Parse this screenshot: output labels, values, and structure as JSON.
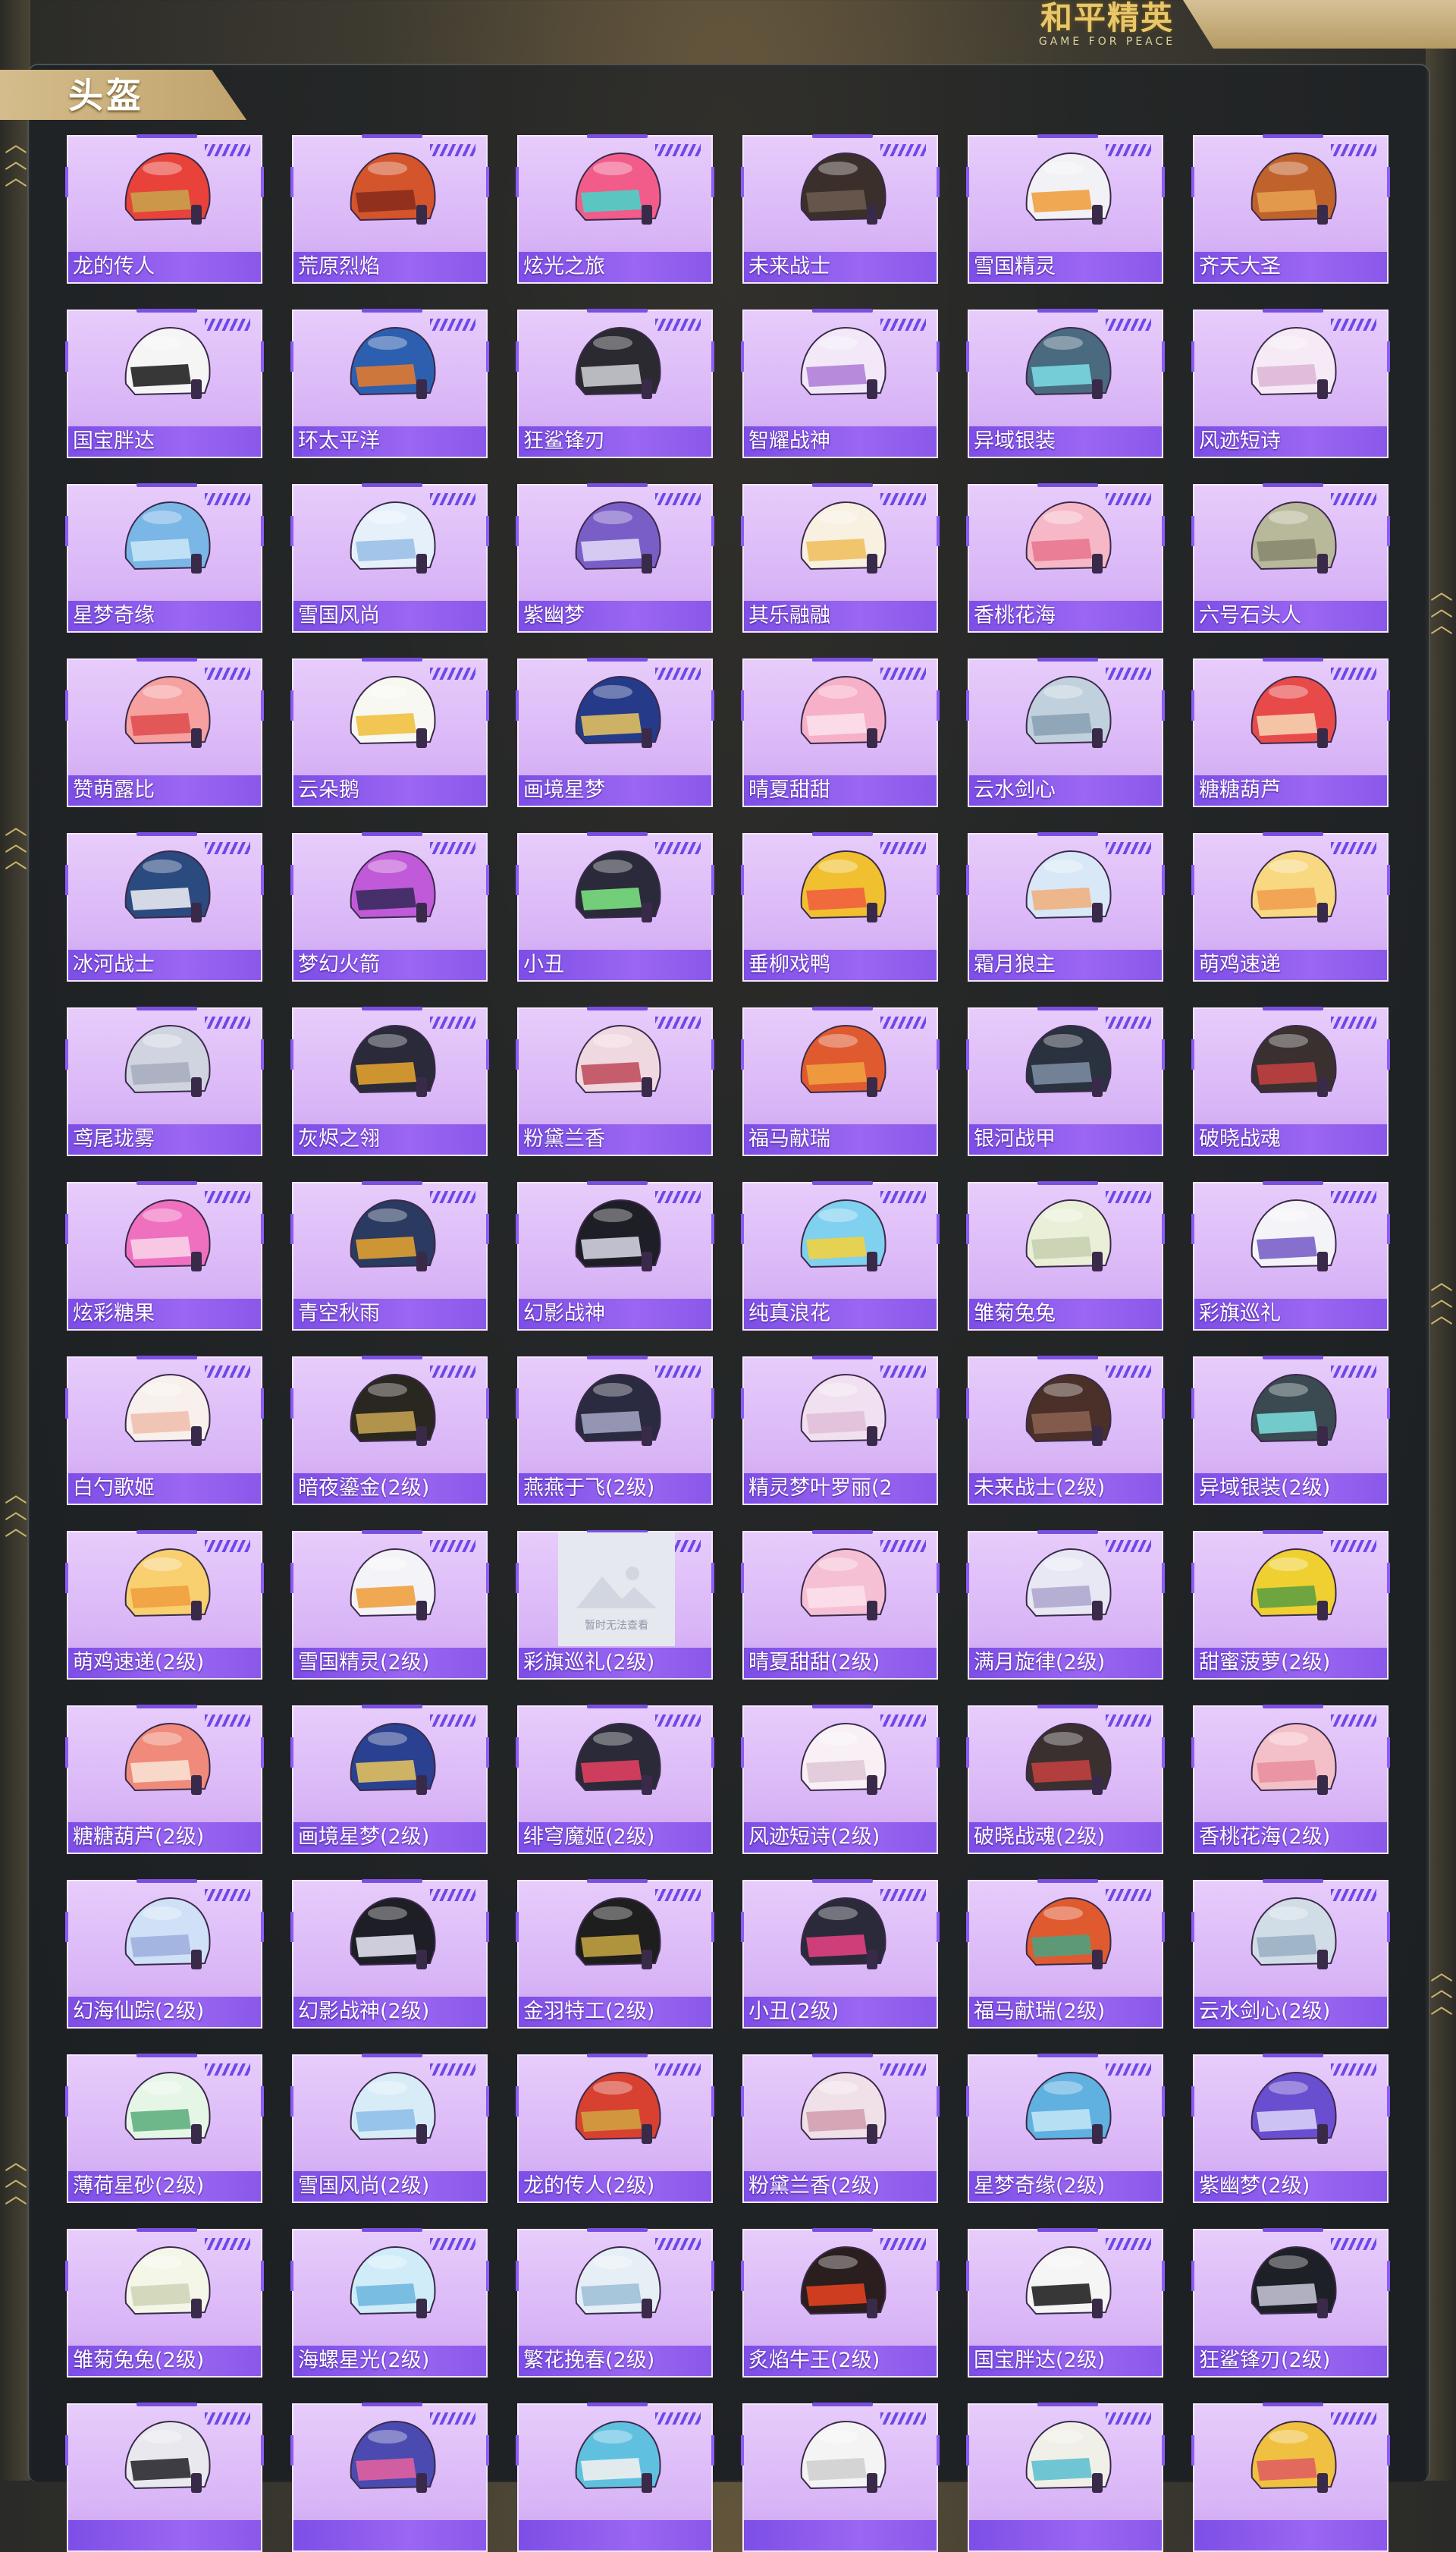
{
  "header": {
    "logo_cn": "和平精英",
    "logo_en": "GAME FOR PEACE",
    "section_title": "头盔"
  },
  "colors": {
    "card_bg": "#d8b4f6",
    "name_band": "#8a58ea",
    "title_tab": "#c8ad78",
    "logo_gold": "#e8c76a"
  },
  "placeholder_text": "暂时无法查看",
  "items": [
    {
      "name": "龙的传人",
      "c1": "#e8423a",
      "c2": "#c9a14a"
    },
    {
      "name": "荒原烈焰",
      "c1": "#d4542c",
      "c2": "#8a2d1c"
    },
    {
      "name": "炫光之旅",
      "c1": "#f25c8a",
      "c2": "#4ad1c7"
    },
    {
      "name": "未来战士",
      "c1": "#3a2f2a",
      "c2": "#6b5a4e"
    },
    {
      "name": "雪国精灵",
      "c1": "#f2f2f6",
      "c2": "#f0a040"
    },
    {
      "name": "齐天大圣",
      "c1": "#c0622c",
      "c2": "#e6a050"
    },
    {
      "name": "国宝胖达",
      "c1": "#f5f5f5",
      "c2": "#222222"
    },
    {
      "name": "环太平洋",
      "c1": "#2d5fb0",
      "c2": "#e07a30"
    },
    {
      "name": "狂鲨锋刃",
      "c1": "#2a2a30",
      "c2": "#c9c9d0"
    },
    {
      "name": "智耀战神",
      "c1": "#f2e8f8",
      "c2": "#b080d8"
    },
    {
      "name": "异域银装",
      "c1": "#4a6a80",
      "c2": "#7ad8e0"
    },
    {
      "name": "风迹短诗",
      "c1": "#f5eaf5",
      "c2": "#e0b8d8"
    },
    {
      "name": "星梦奇缘",
      "c1": "#7ab6e6",
      "c2": "#c8e6f6"
    },
    {
      "name": "雪国风尚",
      "c1": "#e6f0fb",
      "c2": "#9cc0e8"
    },
    {
      "name": "紫幽梦",
      "c1": "#7a5ec8",
      "c2": "#e0d6f6"
    },
    {
      "name": "其乐融融",
      "c1": "#f8f0e0",
      "c2": "#f0c060"
    },
    {
      "name": "香桃花海",
      "c1": "#f6b8c6",
      "c2": "#e87890"
    },
    {
      "name": "六号石头人",
      "c1": "#b8b89a",
      "c2": "#8a8a70"
    },
    {
      "name": "赞萌露比",
      "c1": "#f6a0a0",
      "c2": "#e05050"
    },
    {
      "name": "云朵鹅",
      "c1": "#f8f8f2",
      "c2": "#f0c040"
    },
    {
      "name": "画境星梦",
      "c1": "#263a8a",
      "c2": "#e0c060"
    },
    {
      "name": "晴夏甜甜",
      "c1": "#f6b0c8",
      "c2": "#fbe0ea"
    },
    {
      "name": "云水剑心",
      "c1": "#c0d0dc",
      "c2": "#8aa2b4"
    },
    {
      "name": "糖糖葫芦",
      "c1": "#e84a4a",
      "c2": "#f6d0b0"
    },
    {
      "name": "冰河战士",
      "c1": "#2a4a80",
      "c2": "#e8e8f0"
    },
    {
      "name": "梦幻火箭",
      "c1": "#c05ad8",
      "c2": "#3a2a60"
    },
    {
      "name": "小丑",
      "c1": "#2a2a3a",
      "c2": "#7ae080"
    },
    {
      "name": "垂柳戏鸭",
      "c1": "#f0c030",
      "c2": "#f06040"
    },
    {
      "name": "霜月狼主",
      "c1": "#d8e8f6",
      "c2": "#f0b080"
    },
    {
      "name": "萌鸡速递",
      "c1": "#f8d880",
      "c2": "#f0a050"
    },
    {
      "name": "鸢尾珑雾",
      "c1": "#d0d4e0",
      "c2": "#a8aec0"
    },
    {
      "name": "灰烬之翎",
      "c1": "#2a2a3a",
      "c2": "#e0a030"
    },
    {
      "name": "粉黛兰香",
      "c1": "#f0d8e0",
      "c2": "#c05060"
    },
    {
      "name": "福马献瑞",
      "c1": "#e05a30",
      "c2": "#f0a040"
    },
    {
      "name": "银河战甲",
      "c1": "#2a3240",
      "c2": "#7a8aa0"
    },
    {
      "name": "破晓战魂",
      "c1": "#3a3030",
      "c2": "#c04040"
    },
    {
      "name": "炫彩糖果",
      "c1": "#f070c0",
      "c2": "#f8d0e8"
    },
    {
      "name": "青空秋雨",
      "c1": "#2a3a60",
      "c2": "#e0a030"
    },
    {
      "name": "幻影战神",
      "c1": "#1e1e26",
      "c2": "#d0d0e0"
    },
    {
      "name": "纯真浪花",
      "c1": "#80d0f0",
      "c2": "#f0d040"
    },
    {
      "name": "雏菊兔兔",
      "c1": "#eaf0d8",
      "c2": "#c8d0b0"
    },
    {
      "name": "彩旗巡礼",
      "c1": "#f4f4f8",
      "c2": "#7a60c8"
    },
    {
      "name": "白勺歌姬",
      "c1": "#f8f0ec",
      "c2": "#f0c0b0"
    },
    {
      "name": "暗夜鎏金(2级)",
      "c1": "#2a2620",
      "c2": "#c0a050"
    },
    {
      "name": "燕燕于飞(2级)",
      "c1": "#2a2a40",
      "c2": "#a0a0c0"
    },
    {
      "name": "精灵梦叶罗丽(2",
      "c1": "#f0e0f0",
      "c2": "#e0c0d8"
    },
    {
      "name": "未来战士(2级)",
      "c1": "#4a3028",
      "c2": "#8a6050"
    },
    {
      "name": "异域银装(2级)",
      "c1": "#3a4a50",
      "c2": "#7ad8d8"
    },
    {
      "name": "萌鸡速递(2级)",
      "c1": "#f8d070",
      "c2": "#f0a040"
    },
    {
      "name": "雪国精灵(2级)",
      "c1": "#f4f4f8",
      "c2": "#f0a040"
    },
    {
      "name": "彩旗巡礼(2级)",
      "c1": "#e6e8ef",
      "c2": "#e6e8ef",
      "placeholder": true
    },
    {
      "name": "晴夏甜甜(2级)",
      "c1": "#f6c0d4",
      "c2": "#fbe0ea"
    },
    {
      "name": "满月旋律(2级)",
      "c1": "#e8e8f4",
      "c2": "#b0a8d0"
    },
    {
      "name": "甜蜜菠萝(2级)",
      "c1": "#f0d030",
      "c2": "#60a040"
    },
    {
      "name": "糖糖葫芦(2级)",
      "c1": "#f08a7a",
      "c2": "#f8e0d0"
    },
    {
      "name": "画境星梦(2级)",
      "c1": "#2a4090",
      "c2": "#e0c060"
    },
    {
      "name": "绯穹魔姬(2级)",
      "c1": "#2a2a38",
      "c2": "#e04060"
    },
    {
      "name": "风迹短诗(2级)",
      "c1": "#f8f0f4",
      "c2": "#e0c8d8"
    },
    {
      "name": "破晓战魂(2级)",
      "c1": "#3a3030",
      "c2": "#c04040"
    },
    {
      "name": "香桃花海(2级)",
      "c1": "#f4c0c8",
      "c2": "#e890a0"
    },
    {
      "name": "幻海仙踪(2级)",
      "c1": "#d0e0f6",
      "c2": "#a0b0e0"
    },
    {
      "name": "幻影战神(2级)",
      "c1": "#1e1e26",
      "c2": "#e0e0f0"
    },
    {
      "name": "金羽特工(2级)",
      "c1": "#1e1e1e",
      "c2": "#c0a040"
    },
    {
      "name": "小丑(2级)",
      "c1": "#2a2a3a",
      "c2": "#e04080"
    },
    {
      "name": "福马献瑞(2级)",
      "c1": "#e05a30",
      "c2": "#50a080"
    },
    {
      "name": "云水剑心(2级)",
      "c1": "#d0dce6",
      "c2": "#9ab0c4"
    },
    {
      "name": "薄荷星砂(2级)",
      "c1": "#e6f6e6",
      "c2": "#60b080"
    },
    {
      "name": "雪国风尚(2级)",
      "c1": "#d8ecf8",
      "c2": "#90c0e8"
    },
    {
      "name": "龙的传人(2级)",
      "c1": "#d84030",
      "c2": "#d0a040"
    },
    {
      "name": "粉黛兰香(2级)",
      "c1": "#f0e0e8",
      "c2": "#d0a0b0"
    },
    {
      "name": "星梦奇缘(2级)",
      "c1": "#60b0e0",
      "c2": "#c0e4f6"
    },
    {
      "name": "紫幽梦(2级)",
      "c1": "#6a4ed0",
      "c2": "#d8d0f6"
    },
    {
      "name": "雏菊兔兔(2级)",
      "c1": "#f4f6e8",
      "c2": "#d0d6b8"
    },
    {
      "name": "海螺星光(2级)",
      "c1": "#d0ecf8",
      "c2": "#70b8e0"
    },
    {
      "name": "繁花挽春(2级)",
      "c1": "#e6eef6",
      "c2": "#a0c0d8"
    },
    {
      "name": "炙焰牛王(2级)",
      "c1": "#2a1e1e",
      "c2": "#e04020"
    },
    {
      "name": "国宝胖达(2级)",
      "c1": "#f5f5f5",
      "c2": "#222222"
    },
    {
      "name": "狂鲨锋刃(2级)",
      "c1": "#1e2028",
      "c2": "#c0c0d0"
    },
    {
      "name": "",
      "c1": "#e8e8ee",
      "c2": "#2a2a30"
    },
    {
      "name": "",
      "c1": "#4a4ab0",
      "c2": "#e060a0"
    },
    {
      "name": "",
      "c1": "#60c0e0",
      "c2": "#f0f0f0"
    },
    {
      "name": "",
      "c1": "#f4f4f4",
      "c2": "#d0d0d0"
    },
    {
      "name": "",
      "c1": "#f0f0e8",
      "c2": "#60c0d0"
    },
    {
      "name": "",
      "c1": "#f0c040",
      "c2": "#e06060"
    }
  ]
}
